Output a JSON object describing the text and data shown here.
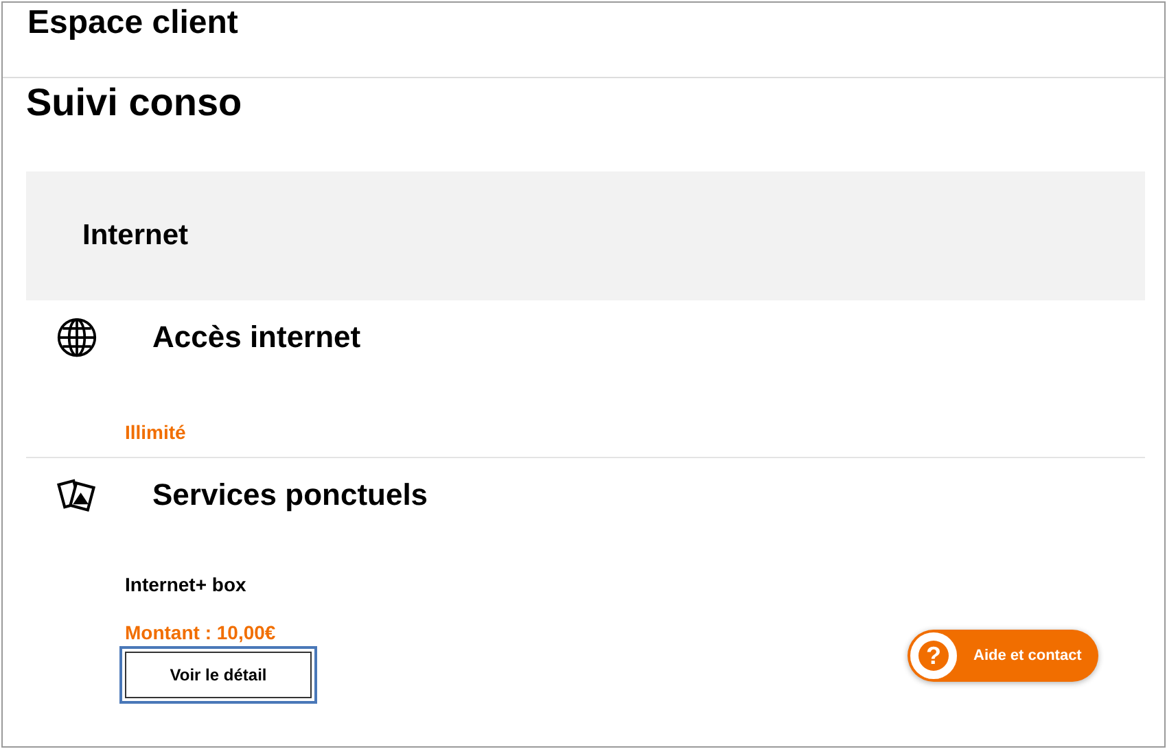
{
  "header": {
    "title": "Espace client"
  },
  "page_title": "Suivi conso",
  "section": {
    "title": "Internet"
  },
  "items": [
    {
      "kind": "globe",
      "title": "Accès internet",
      "status": "Illimité"
    },
    {
      "kind": "cards",
      "title": "Services ponctuels",
      "service": "Internet+ box",
      "amount": "Montant : 10,00€",
      "button": "Voir le détail"
    }
  ],
  "help_button": {
    "glyph": "?",
    "label": "Aide et contact"
  }
}
